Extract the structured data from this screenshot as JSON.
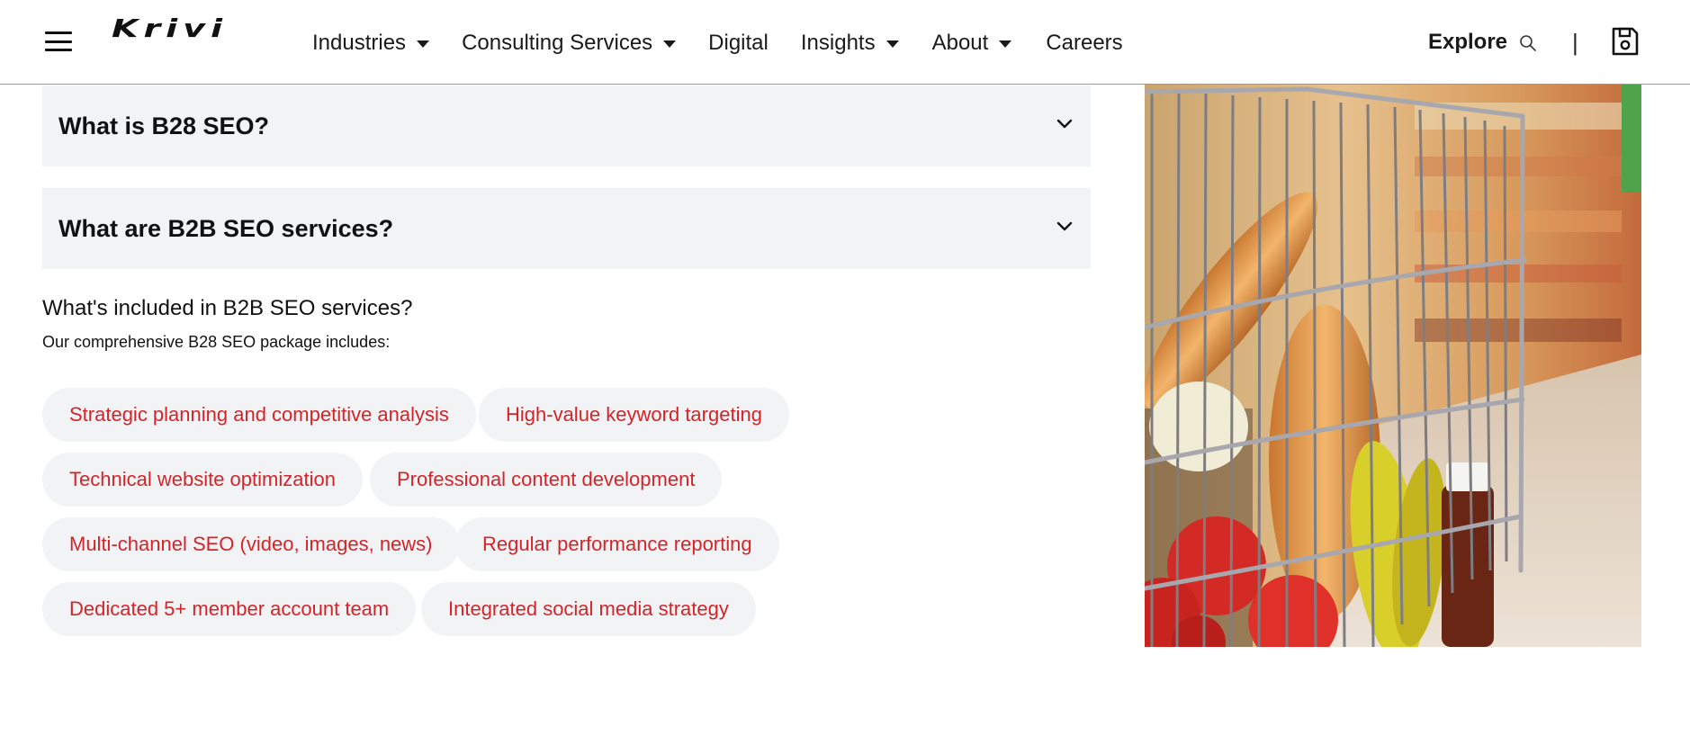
{
  "header": {
    "logo_text": "Krivi",
    "nav": [
      {
        "label": "Industries",
        "has_dropdown": true
      },
      {
        "label": "Consulting Services",
        "has_dropdown": true
      },
      {
        "label": "Digital",
        "has_dropdown": false
      },
      {
        "label": "Insights",
        "has_dropdown": true
      },
      {
        "label": "About",
        "has_dropdown": true
      },
      {
        "label": "Careers",
        "has_dropdown": false
      }
    ],
    "explore_label": "Explore",
    "divider": "|",
    "icons": {
      "menu": "hamburger-menu-icon",
      "search": "search-icon",
      "save": "save-icon"
    }
  },
  "faq": [
    {
      "question": "What is B28 SEO?",
      "expanded": false
    },
    {
      "question": "What are B2B SEO services?",
      "expanded": false
    }
  ],
  "services": {
    "heading": "What's included in B2B SEO services?",
    "subheading": "Our comprehensive B28 SEO package includes:",
    "tags": [
      "Strategic planning and competitive analysis",
      "High-value keyword targeting",
      "Technical website optimization",
      "Professional content development",
      "Multi-channel SEO (video, images, news)",
      "Regular performance reporting",
      "Dedicated 5+ member account team",
      "Integrated social media strategy"
    ]
  },
  "colors": {
    "accent_red": "#d4242a",
    "panel_gray": "#f2f3f5",
    "text_dark": "#111111"
  }
}
